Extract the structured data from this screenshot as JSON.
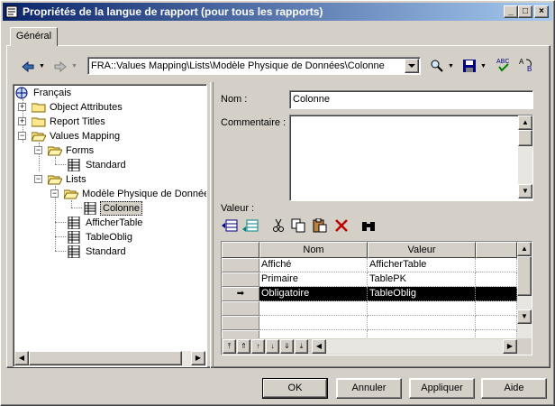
{
  "window": {
    "title": "Propriétés de la langue de rapport (pour tous les rapports)",
    "minimize_symbol": "_",
    "maximize_symbol": "□",
    "close_symbol": "×"
  },
  "tabs": [
    {
      "label": "Général",
      "active": true
    }
  ],
  "toolbar": {
    "path": "FRA::Values Mapping\\Lists\\Modèle Physique de Données\\Colonne",
    "icons": [
      "back-arrow-icon",
      "forward-arrow-icon",
      "find-icon",
      "save-icon",
      "spell-check-icon",
      "translate-icon"
    ]
  },
  "tree": {
    "root": "Français",
    "items": [
      {
        "label": "Object Attributes",
        "expander": "+"
      },
      {
        "label": "Report Titles",
        "expander": "+"
      },
      {
        "label": "Values Mapping",
        "expander": "−"
      },
      {
        "label": "Forms",
        "expander": "−"
      },
      {
        "label": "Standard"
      },
      {
        "label": "Lists",
        "expander": "−"
      },
      {
        "label": "Modèle Physique de Données",
        "expander": "−"
      },
      {
        "label": "Colonne",
        "selected": true
      },
      {
        "label": "AfficherTable"
      },
      {
        "label": "TableOblig"
      },
      {
        "label": "Standard"
      }
    ]
  },
  "form": {
    "name_label": "Nom :",
    "name_value": "Colonne",
    "comment_label": "Commentaire :",
    "comment_value": "",
    "value_label": "Valeur :"
  },
  "grid": {
    "columns": [
      "Nom",
      "Valeur"
    ],
    "rows": [
      {
        "nom": "Affiché",
        "valeur": "AfficherTable",
        "marker": ""
      },
      {
        "nom": "Primaire",
        "valeur": "TablePK",
        "marker": ""
      },
      {
        "nom": "Obligatoire",
        "valeur": "TableOblig",
        "marker": "➡",
        "selected": true
      }
    ]
  },
  "buttons": {
    "ok": "OK",
    "cancel": "Annuler",
    "apply": "Appliquer",
    "help": "Aide"
  },
  "colors": {
    "selection": "#0a246a",
    "titlebar_start": "#0a246a",
    "titlebar_end": "#a6caf0",
    "face": "#d4d0c8"
  }
}
